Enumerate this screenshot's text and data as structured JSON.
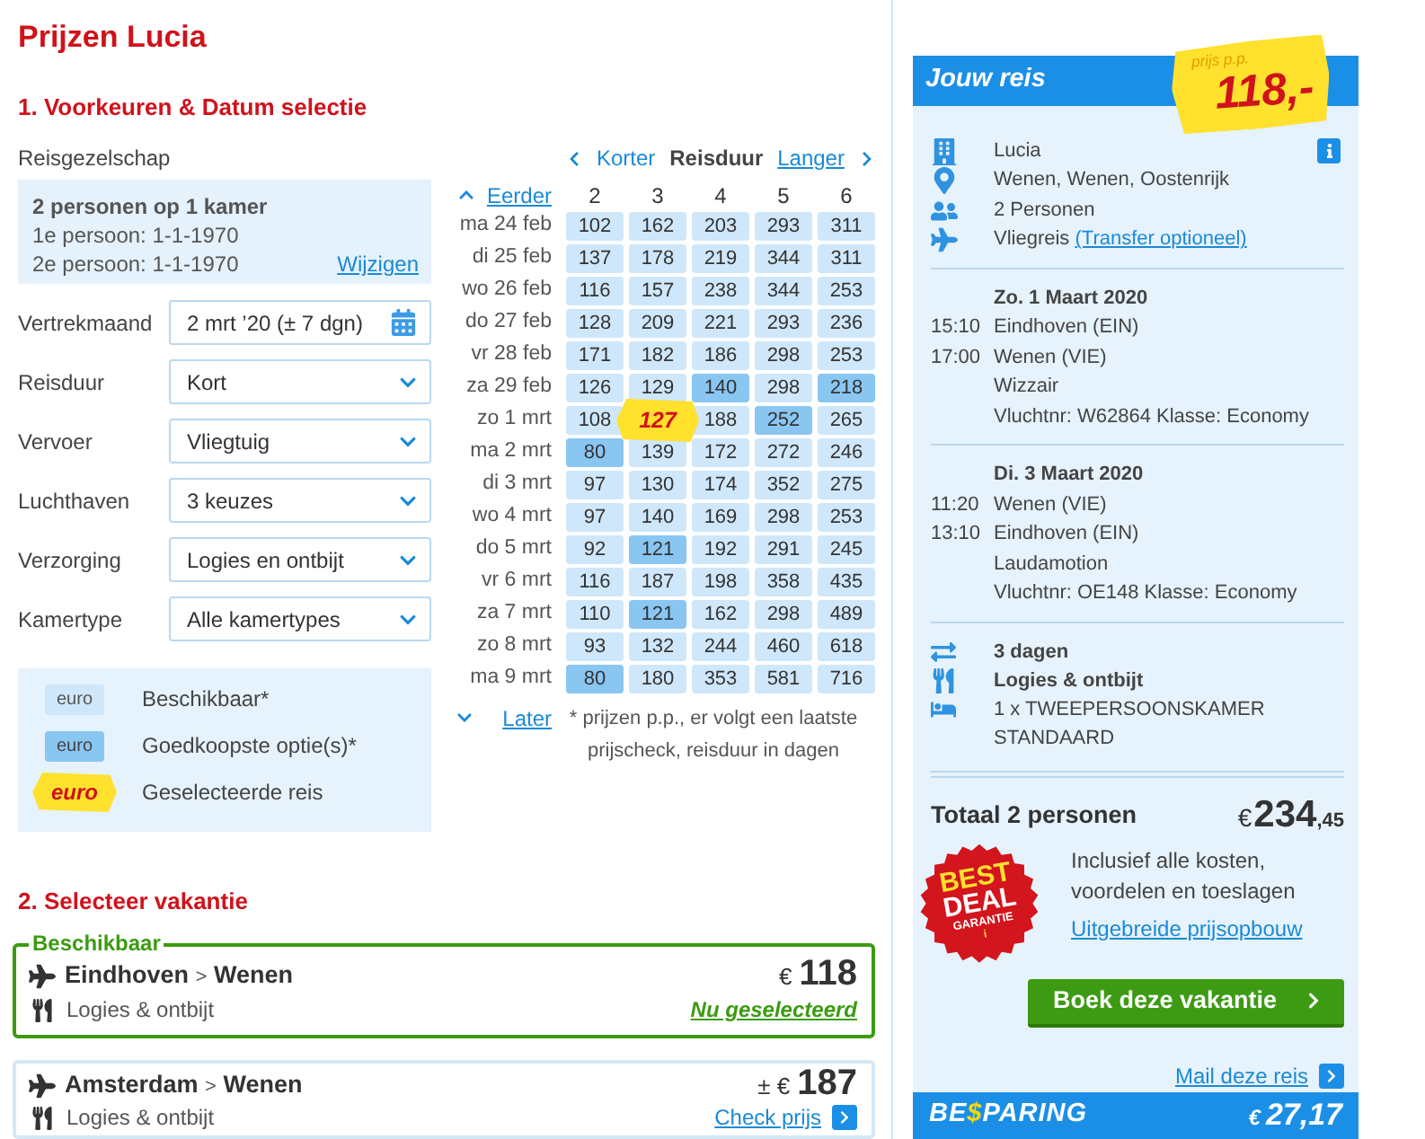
{
  "page_title": "Prijzen Lucia",
  "preferences": {
    "heading": "1. Voorkeuren & Datum selectie",
    "party": {
      "label": "Reisgezelschap",
      "summary": "2 personen op 1 kamer",
      "persons": [
        "1e persoon: 1-1-1970",
        "2e persoon: 1-1-1970"
      ],
      "edit_link": "Wijzigen"
    },
    "fields": [
      {
        "label": "Vertrekmaand",
        "value": "2 mrt ’20 (± 7 dgn)",
        "kind": "date"
      },
      {
        "label": "Reisduur",
        "value": "Kort",
        "kind": "select"
      },
      {
        "label": "Vervoer",
        "value": "Vliegtuig",
        "kind": "select"
      },
      {
        "label": "Luchthaven",
        "value": "3 keuzes",
        "kind": "select"
      },
      {
        "label": "Verzorging",
        "value": "Logies en ontbijt",
        "kind": "select"
      },
      {
        "label": "Kamertype",
        "value": "Alle kamertypes",
        "kind": "select"
      }
    ],
    "legend": [
      {
        "sample": "euro",
        "label": "Beschikbaar*",
        "kind": "available"
      },
      {
        "sample": "euro",
        "label": "Goedkoopste optie(s)*",
        "kind": "cheapest"
      },
      {
        "sample": "euro",
        "label": "Geselecteerde reis",
        "kind": "selected"
      }
    ]
  },
  "price_grid": {
    "shorter": "Korter",
    "duration_label": "Reisduur",
    "longer": "Langer",
    "earlier": "Eerder",
    "later": "Later",
    "columns": [
      "2",
      "3",
      "4",
      "5",
      "6"
    ],
    "rows": [
      {
        "date": "ma 24 feb",
        "cells": [
          {
            "price": "102",
            "cheapest": false,
            "selected": false
          },
          {
            "price": "162",
            "cheapest": false,
            "selected": false
          },
          {
            "price": "203",
            "cheapest": false,
            "selected": false
          },
          {
            "price": "293",
            "cheapest": false,
            "selected": false
          },
          {
            "price": "311",
            "cheapest": false,
            "selected": false
          }
        ]
      },
      {
        "date": "di 25 feb",
        "cells": [
          {
            "price": "137",
            "cheapest": false,
            "selected": false
          },
          {
            "price": "178",
            "cheapest": false,
            "selected": false
          },
          {
            "price": "219",
            "cheapest": false,
            "selected": false
          },
          {
            "price": "344",
            "cheapest": false,
            "selected": false
          },
          {
            "price": "311",
            "cheapest": false,
            "selected": false
          }
        ]
      },
      {
        "date": "wo 26 feb",
        "cells": [
          {
            "price": "116",
            "cheapest": false,
            "selected": false
          },
          {
            "price": "157",
            "cheapest": false,
            "selected": false
          },
          {
            "price": "238",
            "cheapest": false,
            "selected": false
          },
          {
            "price": "344",
            "cheapest": false,
            "selected": false
          },
          {
            "price": "253",
            "cheapest": false,
            "selected": false
          }
        ]
      },
      {
        "date": "do 27 feb",
        "cells": [
          {
            "price": "128",
            "cheapest": false,
            "selected": false
          },
          {
            "price": "209",
            "cheapest": false,
            "selected": false
          },
          {
            "price": "221",
            "cheapest": false,
            "selected": false
          },
          {
            "price": "293",
            "cheapest": false,
            "selected": false
          },
          {
            "price": "236",
            "cheapest": false,
            "selected": false
          }
        ]
      },
      {
        "date": "vr 28 feb",
        "cells": [
          {
            "price": "171",
            "cheapest": false,
            "selected": false
          },
          {
            "price": "182",
            "cheapest": false,
            "selected": false
          },
          {
            "price": "186",
            "cheapest": false,
            "selected": false
          },
          {
            "price": "298",
            "cheapest": false,
            "selected": false
          },
          {
            "price": "253",
            "cheapest": false,
            "selected": false
          }
        ]
      },
      {
        "date": "za 29 feb",
        "cells": [
          {
            "price": "126",
            "cheapest": false,
            "selected": false
          },
          {
            "price": "129",
            "cheapest": false,
            "selected": false
          },
          {
            "price": "140",
            "cheapest": true,
            "selected": false
          },
          {
            "price": "298",
            "cheapest": false,
            "selected": false
          },
          {
            "price": "218",
            "cheapest": true,
            "selected": false
          }
        ]
      },
      {
        "date": "zo 1 mrt",
        "cells": [
          {
            "price": "108",
            "cheapest": false,
            "selected": false
          },
          {
            "price": "127",
            "cheapest": false,
            "selected": true
          },
          {
            "price": "188",
            "cheapest": false,
            "selected": false
          },
          {
            "price": "252",
            "cheapest": true,
            "selected": false
          },
          {
            "price": "265",
            "cheapest": false,
            "selected": false
          }
        ]
      },
      {
        "date": "ma 2 mrt",
        "cells": [
          {
            "price": "80",
            "cheapest": true,
            "selected": false
          },
          {
            "price": "139",
            "cheapest": false,
            "selected": false
          },
          {
            "price": "172",
            "cheapest": false,
            "selected": false
          },
          {
            "price": "272",
            "cheapest": false,
            "selected": false
          },
          {
            "price": "246",
            "cheapest": false,
            "selected": false
          }
        ]
      },
      {
        "date": "di 3 mrt",
        "cells": [
          {
            "price": "97",
            "cheapest": false,
            "selected": false
          },
          {
            "price": "130",
            "cheapest": false,
            "selected": false
          },
          {
            "price": "174",
            "cheapest": false,
            "selected": false
          },
          {
            "price": "352",
            "cheapest": false,
            "selected": false
          },
          {
            "price": "275",
            "cheapest": false,
            "selected": false
          }
        ]
      },
      {
        "date": "wo 4 mrt",
        "cells": [
          {
            "price": "97",
            "cheapest": false,
            "selected": false
          },
          {
            "price": "140",
            "cheapest": false,
            "selected": false
          },
          {
            "price": "169",
            "cheapest": false,
            "selected": false
          },
          {
            "price": "298",
            "cheapest": false,
            "selected": false
          },
          {
            "price": "253",
            "cheapest": false,
            "selected": false
          }
        ]
      },
      {
        "date": "do 5 mrt",
        "cells": [
          {
            "price": "92",
            "cheapest": false,
            "selected": false
          },
          {
            "price": "121",
            "cheapest": true,
            "selected": false
          },
          {
            "price": "192",
            "cheapest": false,
            "selected": false
          },
          {
            "price": "291",
            "cheapest": false,
            "selected": false
          },
          {
            "price": "245",
            "cheapest": false,
            "selected": false
          }
        ]
      },
      {
        "date": "vr 6 mrt",
        "cells": [
          {
            "price": "116",
            "cheapest": false,
            "selected": false
          },
          {
            "price": "187",
            "cheapest": false,
            "selected": false
          },
          {
            "price": "198",
            "cheapest": false,
            "selected": false
          },
          {
            "price": "358",
            "cheapest": false,
            "selected": false
          },
          {
            "price": "435",
            "cheapest": false,
            "selected": false
          }
        ]
      },
      {
        "date": "za 7 mrt",
        "cells": [
          {
            "price": "110",
            "cheapest": false,
            "selected": false
          },
          {
            "price": "121",
            "cheapest": true,
            "selected": false
          },
          {
            "price": "162",
            "cheapest": false,
            "selected": false
          },
          {
            "price": "298",
            "cheapest": false,
            "selected": false
          },
          {
            "price": "489",
            "cheapest": false,
            "selected": false
          }
        ]
      },
      {
        "date": "zo 8 mrt",
        "cells": [
          {
            "price": "93",
            "cheapest": false,
            "selected": false
          },
          {
            "price": "132",
            "cheapest": false,
            "selected": false
          },
          {
            "price": "244",
            "cheapest": false,
            "selected": false
          },
          {
            "price": "460",
            "cheapest": false,
            "selected": false
          },
          {
            "price": "618",
            "cheapest": false,
            "selected": false
          }
        ]
      },
      {
        "date": "ma 9 mrt",
        "cells": [
          {
            "price": "80",
            "cheapest": true,
            "selected": false
          },
          {
            "price": "180",
            "cheapest": false,
            "selected": false
          },
          {
            "price": "353",
            "cheapest": false,
            "selected": false
          },
          {
            "price": "581",
            "cheapest": false,
            "selected": false
          },
          {
            "price": "716",
            "cheapest": false,
            "selected": false
          }
        ]
      }
    ],
    "footnote": "* prijzen p.p., er volgt een laatste prijscheck, reisduur in dagen"
  },
  "holidays": {
    "heading": "2. Selecteer vakantie",
    "options": [
      {
        "status": "Beschikbaar",
        "from": "Eindhoven",
        "separator": ">",
        "to": "Wenen",
        "board": "Logies & ontbijt",
        "currency": "€",
        "price": "118",
        "action": "Nu geselecteerd",
        "selected": true
      },
      {
        "from": "Amsterdam",
        "separator": ">",
        "to": "Wenen",
        "board": "Logies & ontbijt",
        "currency": "± €",
        "price": "187",
        "action": "Check prijs",
        "selected": false
      }
    ]
  },
  "trip": {
    "title": "Jouw reis",
    "price_tag": {
      "caption": "prijs p.p.",
      "amount": "118,-"
    },
    "summary": [
      {
        "kind": "hotel",
        "text": "Lucia"
      },
      {
        "kind": "location",
        "text": "Wenen, Wenen, Oostenrijk"
      },
      {
        "kind": "persons",
        "text": "2 Personen"
      },
      {
        "kind": "transport",
        "text": "Vliegreis",
        "link": "(Transfer optioneel)"
      }
    ],
    "flights": [
      {
        "date": "Zo. 1 Maart 2020",
        "legs": [
          {
            "time": "15:10",
            "place": "Eindhoven (EIN)"
          },
          {
            "time": "17:00",
            "place": "Wenen (VIE)"
          }
        ],
        "carrier": "Wizzair",
        "details": "Vluchtnr: W62864 Klasse: Economy"
      },
      {
        "date": "Di. 3 Maart 2020",
        "legs": [
          {
            "time": "11:20",
            "place": "Wenen (VIE)"
          },
          {
            "time": "13:10",
            "place": "Eindhoven (EIN)"
          }
        ],
        "carrier": "Laudamotion",
        "details": "Vluchtnr: OE148 Klasse: Economy"
      }
    ],
    "stay": [
      {
        "kind": "duration",
        "text": "3 dagen"
      },
      {
        "kind": "board",
        "text": "Logies & ontbijt"
      },
      {
        "kind": "room",
        "text": "1 x TWEEPERSOONSKAMER STANDAARD"
      }
    ],
    "total": {
      "label": "Totaal 2 personen",
      "currency": "€",
      "amount": "234",
      "cents": ",45"
    },
    "guarantee": {
      "lines": [
        "BEST",
        "DEAL",
        "GARANTIE"
      ],
      "mark": "i"
    },
    "includes": "Inclusief alle kosten, voordelen en toeslagen",
    "breakdown_link": "Uitgebreide prijsopbouw",
    "book_button": "Boek deze vakantie",
    "mail_link": "Mail deze reis",
    "savings": {
      "label": [
        {
          "text": "BE",
          "highlight": false
        },
        {
          "text": "$",
          "highlight": true
        },
        {
          "text": "PARING",
          "highlight": false
        }
      ],
      "currency": "€",
      "amount": "27,17"
    }
  }
}
